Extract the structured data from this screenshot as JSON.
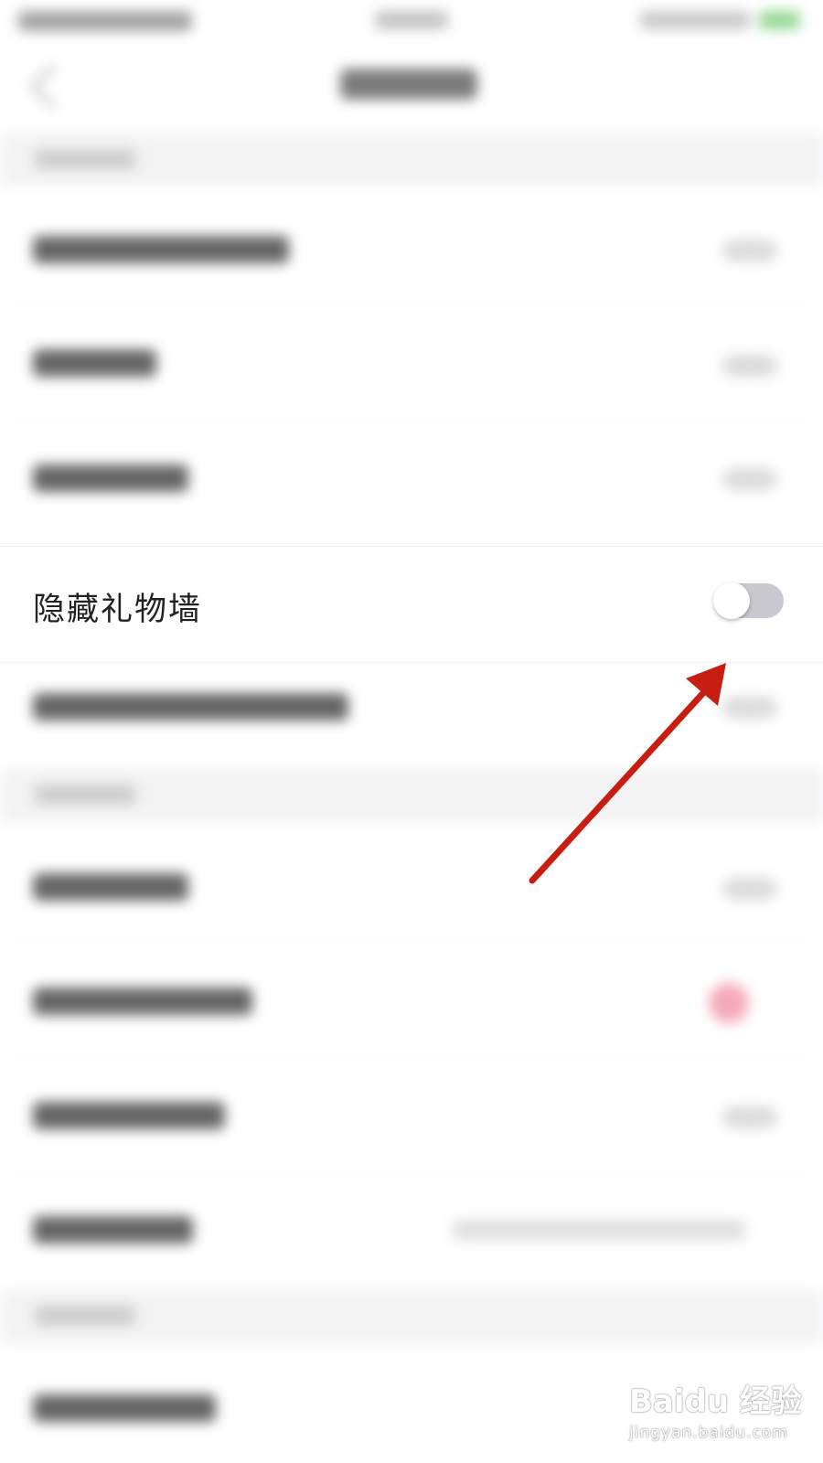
{
  "setting": {
    "label": "隐藏礼物墙",
    "enabled": false
  },
  "watermark": {
    "main": "Baidu 经验",
    "sub": "jingyan.baidu.com"
  },
  "colors": {
    "toggle_off_track": "#c9c8cf",
    "annotation_arrow": "#c81e12",
    "label_text": "#222222"
  },
  "icons": {
    "arrow": "red-annotation-arrow",
    "paw": "baidu-paw-icon"
  }
}
